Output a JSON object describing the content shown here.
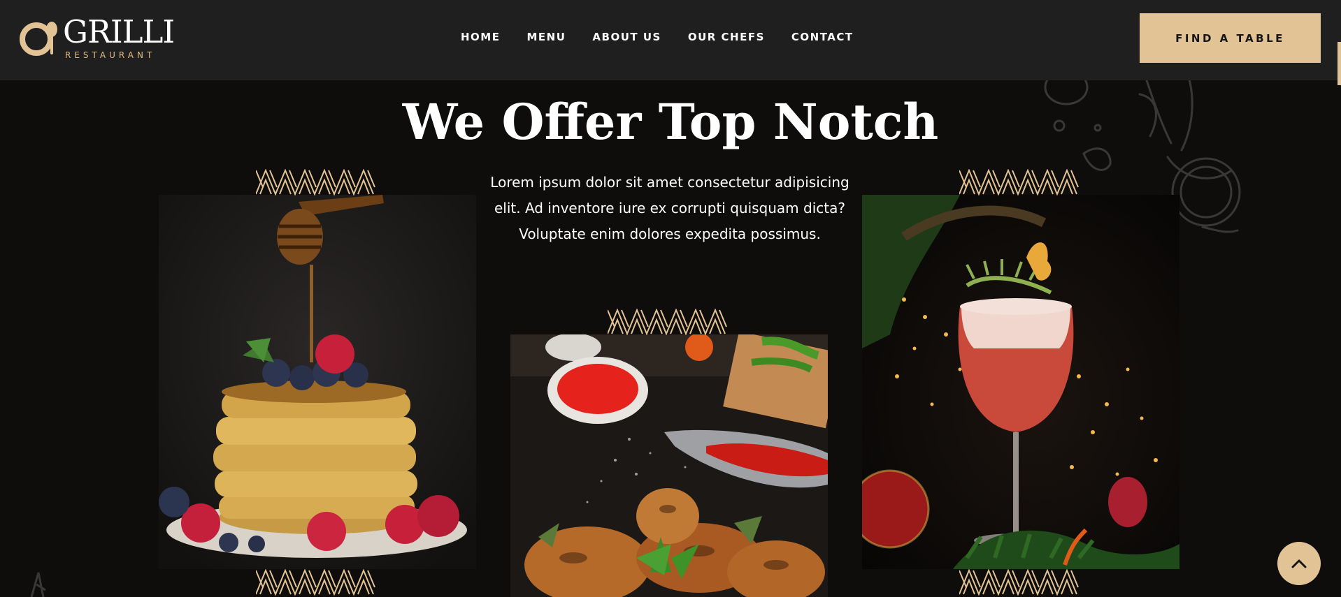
{
  "brand": {
    "name": "GRILLI",
    "tagline": "RESTAURANT",
    "accent": "#e2c395",
    "header_bg": "#1f1f20",
    "page_bg": "#0e0d0c"
  },
  "nav": {
    "items": [
      {
        "label": "HOME"
      },
      {
        "label": "MENU"
      },
      {
        "label": "ABOUT US"
      },
      {
        "label": "OUR CHEFS"
      },
      {
        "label": "CONTACT"
      }
    ],
    "cta_label": "FIND A TABLE"
  },
  "section": {
    "title": "We Offer Top Notch",
    "description": "Lorem ipsum dolor sit amet consectetur adipisicing elit. Ad inventore iure ex corrupti quisquam dicta? Voluptate enim dolores expedita possimus."
  },
  "cards": [
    {
      "image_icon": "pancakes-image"
    },
    {
      "image_icon": "grilled-chicken-image"
    },
    {
      "image_icon": "cocktail-image"
    }
  ],
  "icons": {
    "logo": "fork-spoon-logo-icon",
    "back_to_top": "chevron-up-icon"
  }
}
